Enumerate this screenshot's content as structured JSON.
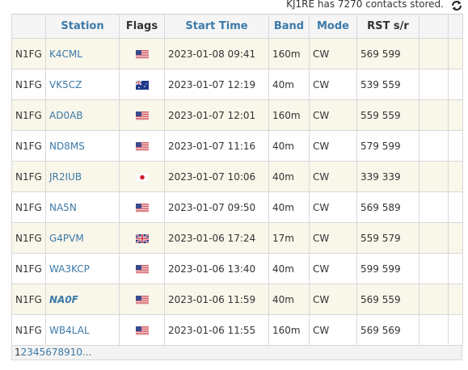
{
  "status": {
    "text": "KJ1RE has 7270 contacts stored."
  },
  "table": {
    "headers": {
      "col1": "",
      "station": "Station",
      "flags": "Flags",
      "start_time": "Start Time",
      "band": "Band",
      "mode": "Mode",
      "rst": "RST s/r",
      "extra1": "",
      "extra2": ""
    },
    "rows": [
      {
        "op": "N1FG",
        "station": "K4CML",
        "flag": "us",
        "time": "2023-01-08 09:41",
        "band": "160m",
        "mode": "CW",
        "rst": "569 599"
      },
      {
        "op": "N1FG",
        "station": "VK5CZ",
        "flag": "au",
        "time": "2023-01-07 12:19",
        "band": "40m",
        "mode": "CW",
        "rst": "539 559"
      },
      {
        "op": "N1FG",
        "station": "AD0AB",
        "flag": "us",
        "time": "2023-01-07 12:01",
        "band": "160m",
        "mode": "CW",
        "rst": "559 559"
      },
      {
        "op": "N1FG",
        "station": "ND8MS",
        "flag": "us",
        "time": "2023-01-07 11:16",
        "band": "40m",
        "mode": "CW",
        "rst": "579 599"
      },
      {
        "op": "N1FG",
        "station": "JR2IUB",
        "flag": "jp",
        "time": "2023-01-07 10:06",
        "band": "40m",
        "mode": "CW",
        "rst": "339 339"
      },
      {
        "op": "N1FG",
        "station": "NA5N",
        "flag": "us",
        "time": "2023-01-07 09:50",
        "band": "40m",
        "mode": "CW",
        "rst": "569 589"
      },
      {
        "op": "N1FG",
        "station": "G4PVM",
        "flag": "gb",
        "time": "2023-01-06 17:24",
        "band": "17m",
        "mode": "CW",
        "rst": "559 579"
      },
      {
        "op": "N1FG",
        "station": "WA3KCP",
        "flag": "us",
        "time": "2023-01-06 13:40",
        "band": "40m",
        "mode": "CW",
        "rst": "599 599"
      },
      {
        "op": "N1FG",
        "station": "NA0F",
        "flag": "us",
        "time": "2023-01-06 11:59",
        "band": "40m",
        "mode": "CW",
        "rst": "569 559",
        "emphasis": true
      },
      {
        "op": "N1FG",
        "station": "WB4LAL",
        "flag": "us",
        "time": "2023-01-06 11:55",
        "band": "160m",
        "mode": "CW",
        "rst": "569 569"
      }
    ]
  },
  "pager": {
    "pages": [
      "1",
      "2",
      "3",
      "4",
      "5",
      "6",
      "7",
      "8",
      "9",
      "10",
      "..."
    ],
    "current": "1"
  },
  "colors": {
    "link": "#3c7aa8",
    "row_alt": "#f9f6ea"
  }
}
